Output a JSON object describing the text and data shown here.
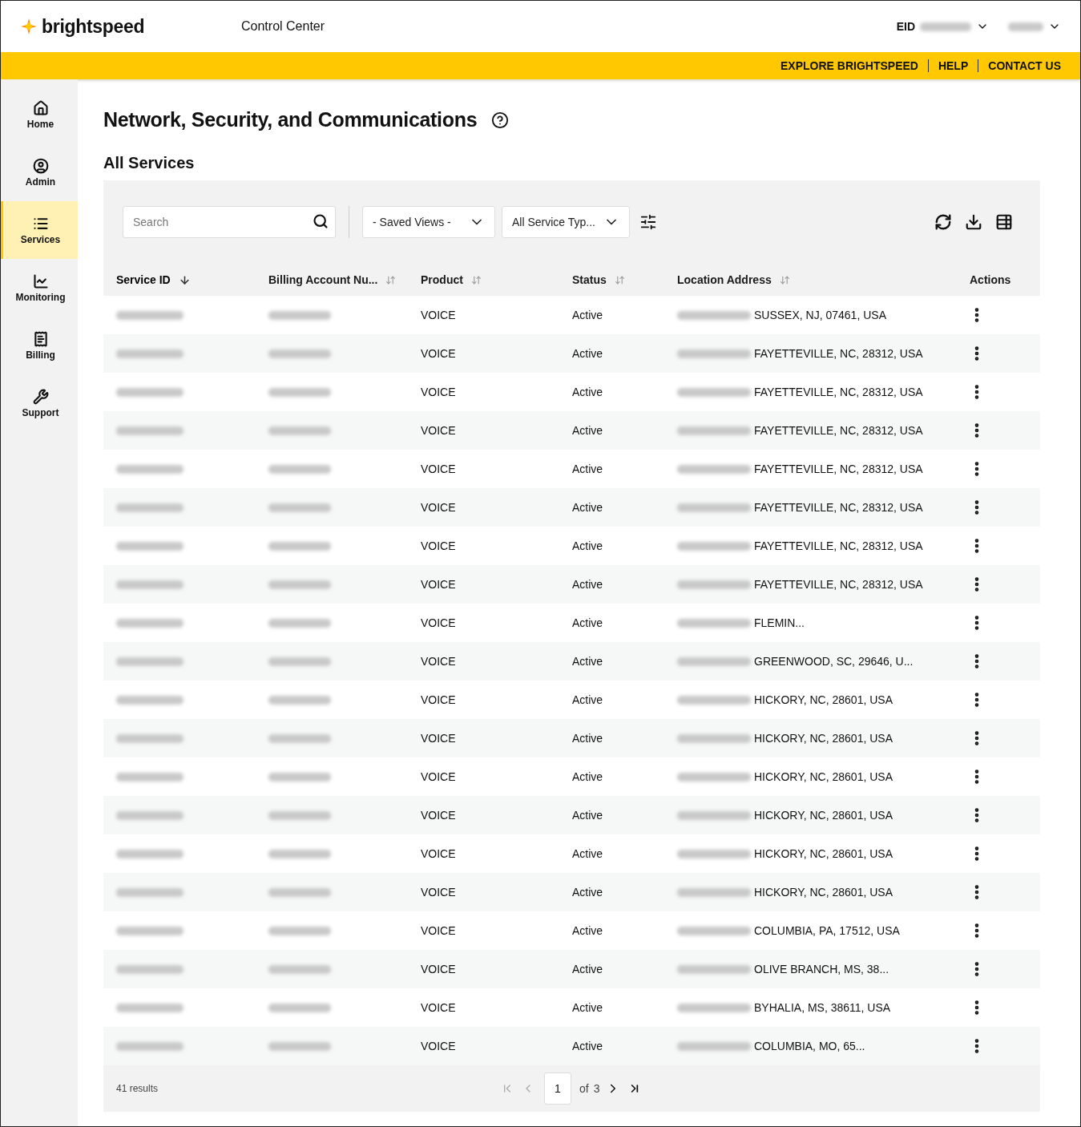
{
  "header": {
    "brand": "brightspeed",
    "app_title": "Control Center",
    "eid_label": "EID"
  },
  "top_links": [
    "EXPLORE BRIGHTSPEED",
    "HELP",
    "CONTACT US"
  ],
  "sidebar": {
    "items": [
      {
        "label": "Home",
        "selected": false
      },
      {
        "label": "Admin",
        "selected": false
      },
      {
        "label": "Services",
        "selected": true
      },
      {
        "label": "Monitoring",
        "selected": false
      },
      {
        "label": "Billing",
        "selected": false
      },
      {
        "label": "Support",
        "selected": false
      }
    ]
  },
  "page_title": "Network, Security, and Communications",
  "section_title": "All Services",
  "toolbar": {
    "search": {
      "placeholder": "Search"
    },
    "saved_views": "- Saved Views -",
    "service_type": "All Service Typ..."
  },
  "table": {
    "columns": [
      {
        "label": "Service ID",
        "sortable": true,
        "sorted": true
      },
      {
        "label": "Billing Account Nu...",
        "sortable": true,
        "sorted": false
      },
      {
        "label": "Product",
        "sortable": true,
        "sorted": false
      },
      {
        "label": "Status",
        "sortable": true,
        "sorted": false
      },
      {
        "label": "Location Address",
        "sortable": true,
        "sorted": false
      },
      {
        "label": "Actions",
        "sortable": false,
        "sorted": false
      }
    ],
    "rows": [
      {
        "product": "VOICE",
        "status": "Active",
        "address": "SUSSEX, NJ, 07461, USA"
      },
      {
        "product": "VOICE",
        "status": "Active",
        "address": "FAYETTEVILLE, NC, 28312, USA"
      },
      {
        "product": "VOICE",
        "status": "Active",
        "address": "FAYETTEVILLE, NC, 28312, USA"
      },
      {
        "product": "VOICE",
        "status": "Active",
        "address": "FAYETTEVILLE, NC, 28312, USA"
      },
      {
        "product": "VOICE",
        "status": "Active",
        "address": "FAYETTEVILLE, NC, 28312, USA"
      },
      {
        "product": "VOICE",
        "status": "Active",
        "address": "FAYETTEVILLE, NC, 28312, USA"
      },
      {
        "product": "VOICE",
        "status": "Active",
        "address": "FAYETTEVILLE, NC, 28312, USA"
      },
      {
        "product": "VOICE",
        "status": "Active",
        "address": "FAYETTEVILLE, NC, 28312, USA"
      },
      {
        "product": "VOICE",
        "status": "Active",
        "address": "FLEMIN..."
      },
      {
        "product": "VOICE",
        "status": "Active",
        "address": "GREENWOOD, SC, 29646, U..."
      },
      {
        "product": "VOICE",
        "status": "Active",
        "address": "HICKORY, NC, 28601, USA"
      },
      {
        "product": "VOICE",
        "status": "Active",
        "address": "HICKORY, NC, 28601, USA"
      },
      {
        "product": "VOICE",
        "status": "Active",
        "address": "HICKORY, NC, 28601, USA"
      },
      {
        "product": "VOICE",
        "status": "Active",
        "address": "HICKORY, NC, 28601, USA"
      },
      {
        "product": "VOICE",
        "status": "Active",
        "address": "HICKORY, NC, 28601, USA"
      },
      {
        "product": "VOICE",
        "status": "Active",
        "address": "HICKORY, NC, 28601, USA"
      },
      {
        "product": "VOICE",
        "status": "Active",
        "address": "COLUMBIA, PA, 17512, USA"
      },
      {
        "product": "VOICE",
        "status": "Active",
        "address": "OLIVE BRANCH, MS, 38..."
      },
      {
        "product": "VOICE",
        "status": "Active",
        "address": "BYHALIA, MS, 38611, USA"
      },
      {
        "product": "VOICE",
        "status": "Active",
        "address": "COLUMBIA, MO, 65..."
      }
    ]
  },
  "pagination": {
    "results": "41 results",
    "page": "1",
    "of": "of",
    "total": "3",
    "first_disabled": true,
    "prev_disabled": true,
    "next_disabled": false,
    "last_disabled": false
  }
}
